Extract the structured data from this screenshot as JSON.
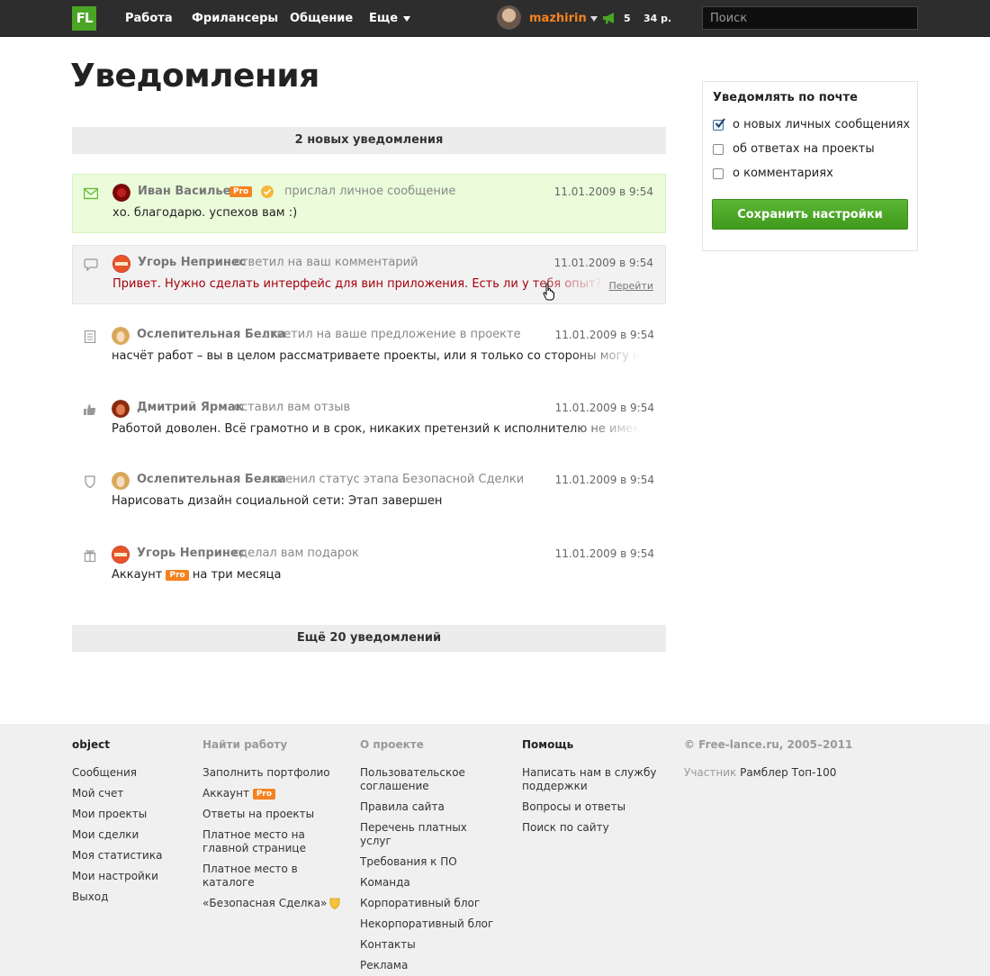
{
  "header": {
    "logo": "FL",
    "nav": [
      {
        "label": "Работа"
      },
      {
        "label": "Фрилансеры"
      },
      {
        "label": "Общение"
      },
      {
        "label": "Еще"
      }
    ],
    "username": "mazhirin",
    "counter": "5",
    "balance": "34 р.",
    "search_placeholder": "Поиск"
  },
  "page_title": "Уведомления",
  "new_bar": "2 новых уведомления",
  "more_bar": "Ещё 20 уведомлений",
  "pro_badge": "Pro",
  "notifications": [
    {
      "icon": "envelope-icon",
      "author": "Иван Васильев",
      "action": "прислал личное сообщение",
      "date": "11.01.2009 в 9:54",
      "text": "хо. благодарю. успехов вам :)",
      "state": "unread"
    },
    {
      "icon": "comment-icon",
      "author": "Угорь Непринес",
      "action": "ответил на ваш комментарий",
      "date": "11.01.2009 в 9:54",
      "text": "Привет. Нужно сделать интерфейс для вин приложения. Есть ли у тебя опыт? Как со времени",
      "go": "Перейти",
      "state": "hover"
    },
    {
      "icon": "document-icon",
      "author": "Ослепительная Белка",
      "action": "ответил на ваше предложение в проекте",
      "date": "11.01.2009 в 9:54",
      "text": "насчёт работ – вы в целом рассматриваете проекты, или я только со стороны могу наблюдать от"
    },
    {
      "icon": "thumbs-up-icon",
      "author": "Дмитрий Ярмак",
      "action": "оставил вам отзыв",
      "date": "11.01.2009 в 9:54",
      "text": "Работой доволен. Всё грамотно и в срок, никаких претензий к исполнителю не имею. Спасибо!"
    },
    {
      "icon": "shield-icon",
      "author": "Ослепительная Белка",
      "action": "изменил статус этапа Безопасной Сделки",
      "date": "11.01.2009 в 9:54",
      "text": "Нарисовать дизайн социальной сети: Этап завершен"
    },
    {
      "icon": "gift-icon",
      "author": "Угорь Непринес",
      "action": "сделал вам подарок",
      "date": "11.01.2009 в 9:54",
      "text_before": "Аккаунт",
      "text_after": "на три месяца"
    }
  ],
  "settings": {
    "title": "Уведомлять по почте",
    "options": [
      {
        "label": "о новых личных сообщениях",
        "checked": true
      },
      {
        "label": "об ответах на проекты",
        "checked": false
      },
      {
        "label": "о комментариях",
        "checked": false
      }
    ],
    "save_label": "Сохранить настройки"
  },
  "footer": {
    "col1": {
      "title": "object",
      "links": [
        "Сообщения",
        "Мой счет",
        "Мои проекты",
        "Мои сделки",
        "Моя статистика",
        "Мои настройки",
        "Выход"
      ]
    },
    "col2": {
      "title": "Найти работу",
      "links": [
        "Заполнить портфолио",
        "Аккаунт",
        "Ответы на проекты",
        "Платное место на главной странице",
        "Платное место в каталоге",
        "«Безопасная Сделка»"
      ]
    },
    "col3": {
      "title": "О проекте",
      "links": [
        "Пользовательское соглашение",
        "Правила сайта",
        "Перечень платных услуг",
        "Требования к ПО",
        "Команда",
        "Корпоративный блог",
        "Некорпоративный блог",
        "Контакты",
        "Реклама"
      ]
    },
    "col4": {
      "title": "Помощь",
      "links": [
        "Написать нам в службу поддержки",
        "Вопросы и ответы",
        "Поиск по сайту"
      ]
    },
    "copyright": "© Free-lance.ru, 2005–2011",
    "member_label": "Участник",
    "member_link": "Рамблер Топ-100"
  }
}
